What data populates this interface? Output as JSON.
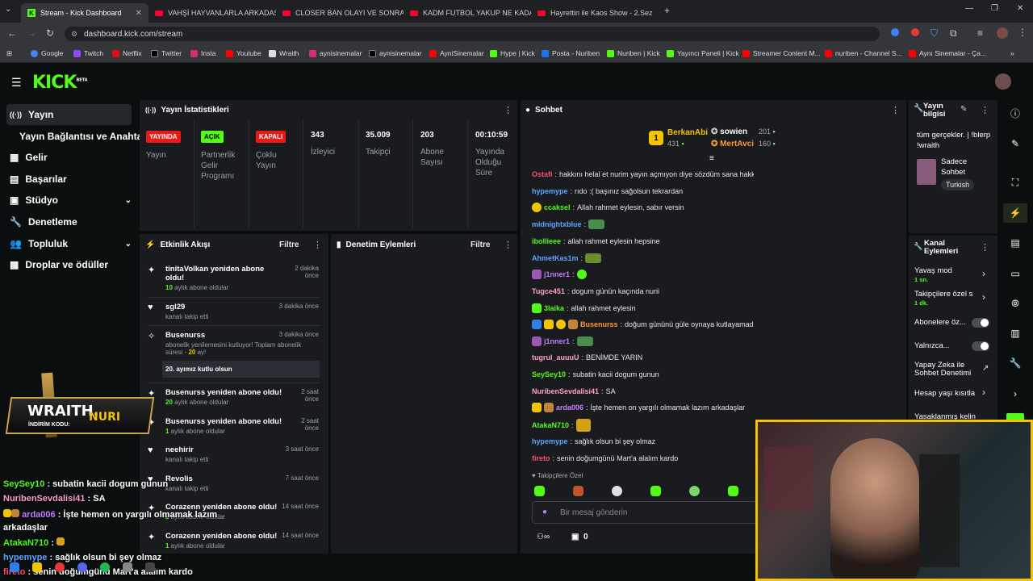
{
  "browser": {
    "tabs": [
      {
        "title": "Stream - Kick Dashboard",
        "icon": "kick-icon",
        "active": true
      },
      {
        "title": "VAHŞİ HAYVANLARLA ARKADAŞ",
        "icon": "youtube-icon"
      },
      {
        "title": "CLOSER BAN OLAYI VE SONRA",
        "icon": "youtube-icon"
      },
      {
        "title": "KADM FUTBOL YAKUP NE KADA",
        "icon": "youtube-icon"
      },
      {
        "title": "Hayrettin ile Kaos Show - 2.Sez",
        "icon": "youtube-icon"
      }
    ],
    "url": "dashboard.kick.com/stream",
    "bookmarks": [
      "Google",
      "Twitch",
      "Netflix",
      "Twitter",
      "Insta",
      "Youtube",
      "Wraith",
      "aynisinemalar",
      "aynisinemalar",
      "AyniSinemalar",
      "Hype | Kick",
      "Posta - Nuriben",
      "Nuriben | Kick",
      "Yayıncı Paneli | Kick",
      "Streamer Content M...",
      "nuriben - Channel S...",
      "Aynı Sinemalar - Ça..."
    ]
  },
  "brand": {
    "logo": "KICK",
    "beta": "BETA",
    "accent": "#53fc18"
  },
  "sidebar": {
    "items": [
      {
        "label": "Yayın",
        "icon": "broadcast-icon"
      },
      {
        "label": "Yayın Bağlantısı ve Anahtarı",
        "icon": ""
      },
      {
        "label": "Gelir",
        "icon": "money-icon"
      },
      {
        "label": "Başarılar",
        "icon": "trophy-icon"
      },
      {
        "label": "Stüdyo",
        "icon": "studio-icon"
      },
      {
        "label": "Denetleme",
        "icon": "wrench-icon"
      },
      {
        "label": "Topluluk",
        "icon": "community-icon"
      },
      {
        "label": "Droplar ve ödüller",
        "icon": "gift-icon"
      }
    ]
  },
  "stats": {
    "title": "Yayın İstatistikleri",
    "badges": [
      {
        "badge": "YAYINDA",
        "label": "Yayın",
        "color": "#e91916"
      },
      {
        "badge": "AÇIK",
        "label": "Partnerlik Gelir Programı",
        "color": "#53fc18"
      },
      {
        "badge": "KAPALI",
        "label": "Çoklu Yayın",
        "color": "#e91916"
      }
    ],
    "numbers": [
      {
        "value": "343",
        "label": "İzleyici"
      },
      {
        "value": "35.009",
        "label": "Takipçi"
      },
      {
        "value": "203",
        "label": "Abone Sayısı"
      },
      {
        "value": "00:10:59",
        "label": "Yayında Olduğu Süre"
      }
    ]
  },
  "activity": {
    "title": "Etkinlik Akışı",
    "filter": "Filtre",
    "items": [
      {
        "title": "tinitaVolkan yeniden abone oldu!",
        "num": "10",
        "sub": " aylık abone oldular",
        "time": "2 dakika önce"
      },
      {
        "title": "sgl29",
        "sub": "kanalı takip etti",
        "time": "3 dakika önce"
      },
      {
        "title": "Busenurss",
        "sub": "abonelik yenilemesini kutluyor! Toplam abonelik süresi - ",
        "num2": "20",
        "sub2": " ay!",
        "msg": "20. ayımız kutlu olsun",
        "time": "3 dakika önce"
      },
      {
        "title": "Busenurss yeniden abone oldu!",
        "num": "20",
        "sub": " aylık abone oldular",
        "time": "2 saat önce"
      },
      {
        "title": "Busenurss yeniden abone oldu!",
        "num": "1",
        "sub": " aylık abone oldular",
        "time": "2 saat önce"
      },
      {
        "title": "neehirir",
        "sub": "kanalı takip etti",
        "time": "3 saat önce"
      },
      {
        "title": "Revolis",
        "sub": "kanalı takip etti",
        "time": "7 saat önce"
      },
      {
        "title": "Corazenn yeniden abone oldu!",
        "num": "2",
        "sub": " aylık abone oldular",
        "time": "14 saat önce"
      },
      {
        "title": "Corazenn yeniden abone oldu!",
        "num": "1",
        "sub": " aylık abone oldular",
        "time": "14 saat önce"
      }
    ]
  },
  "moderation": {
    "title": "Denetim Eylemleri",
    "filter": "Filtre"
  },
  "chat": {
    "title": "Sohbet",
    "top": [
      {
        "rank": "1",
        "name": "BerkanAbi",
        "count": "431"
      },
      {
        "rank": "",
        "name": "sowien",
        "count": "201"
      },
      {
        "rank": "",
        "name": "MertAvci",
        "count": "160"
      }
    ],
    "messages": [
      {
        "user": "Ostafi",
        "color": "#ff4d6d",
        "text": "hakkını helal et nurim yayın açmıyon diye sözdüm sana hakkını yemişim"
      },
      {
        "user": "hypemype",
        "color": "#59a8ff",
        "text": "rıdo :( başınız sağolsun tekrardan"
      },
      {
        "user": "ccaksel",
        "color": "#53fc18",
        "text": "Allah rahmet eylesin, sabır versin"
      },
      {
        "user": "midnightxblue",
        "color": "#59a8ff",
        "text": ""
      },
      {
        "user": "ibollieee",
        "color": "#53fc18",
        "text": "allah rahmet eylesin hepsine"
      },
      {
        "user": "AhmetKas1m",
        "color": "#59a8ff",
        "text": ""
      },
      {
        "user": "j1nner1",
        "color": "#c77dff",
        "text": ""
      },
      {
        "user": "Tugce451",
        "color": "#ff9ecb",
        "text": "dogum günün kaçında nurii"
      },
      {
        "user": "3laika",
        "color": "#53fc18",
        "text": "allah rahmet eylesin"
      },
      {
        "user": "Busenurss",
        "color": "#ff9a2e",
        "text": "doğum gününü güle oynaya kutlayamadık bi ya"
      },
      {
        "user": "j1nner1",
        "color": "#c77dff",
        "text": ""
      },
      {
        "user": "tugrul_auuuU",
        "color": "#ff9ecb",
        "text": "BENİMDE YARIN"
      },
      {
        "user": "SeySey10",
        "color": "#53fc18",
        "text": "subatin kacii dogum gunun"
      },
      {
        "user": "NuribenSevdalisi41",
        "color": "#ff9ecb",
        "text": "SA"
      },
      {
        "user": "arda006",
        "color": "#c77dff",
        "text": "İşte hemen on yargılı olmamak lazım arkadaşlar"
      },
      {
        "user": "AtakaN710",
        "color": "#53fc18",
        "text": ""
      },
      {
        "user": "hypemype",
        "color": "#59a8ff",
        "text": "sağlık olsun bi şey olmaz"
      },
      {
        "user": "fireto",
        "color": "#ff4d6d",
        "text": "senin doğumgünü Mart'a alalım kardo"
      }
    ],
    "mode": "Takipçilere Özel",
    "placeholder": "Bir mesaj gönderin",
    "counter": "0"
  },
  "stream_info": {
    "title": "Yayın bilgisi",
    "text": "tüm gerçekler. | !blerp !wraith",
    "category": "Sadece Sohbet",
    "language": "Turkish"
  },
  "channel_actions": {
    "title": "Kanal Eylemleri",
    "items": [
      {
        "label": "Yavaş mod",
        "sub": "1 sn."
      },
      {
        "label": "Takipçilere özel s",
        "sub": "1 dk."
      },
      {
        "label": "Abonelere öz...",
        "sub": ""
      },
      {
        "label": "Yalnızca...",
        "sub": ""
      },
      {
        "label": "Yapay Zeka ile Sohbet Denetimi",
        "sub": ""
      },
      {
        "label": "Hesap yaşı kısıtla",
        "sub": ""
      },
      {
        "label": "Yasaklanmış kelin",
        "sub": ""
      }
    ]
  },
  "overlay": {
    "banner_brand": "WRAITH.",
    "banner_code_label": "İNDİRİM KODU:",
    "banner_code": "NURI",
    "chat": [
      {
        "user": "SeySey10",
        "color": "#53fc18",
        "text": " : subatin kacii dogum gunun"
      },
      {
        "user": "NuribenSevdalisi41",
        "color": "#ff9ecb",
        "text": " : SA"
      },
      {
        "user": "arda006",
        "color": "#c77dff",
        "text": " : İşte hemen on yargılı olmamak lazım"
      },
      {
        "user": "",
        "color": "#fff",
        "text": "arkadaşlar"
      },
      {
        "user": "AtakaN710",
        "color": "#53fc18",
        "text": " : "
      },
      {
        "user": "hypemype",
        "color": "#59a8ff",
        "text": " : sağlık olsun bi şey olmaz"
      },
      {
        "user": "fireto",
        "color": "#ff4d6d",
        "text": " : senin doğumgünü Mart'a alalım kardo"
      }
    ]
  }
}
